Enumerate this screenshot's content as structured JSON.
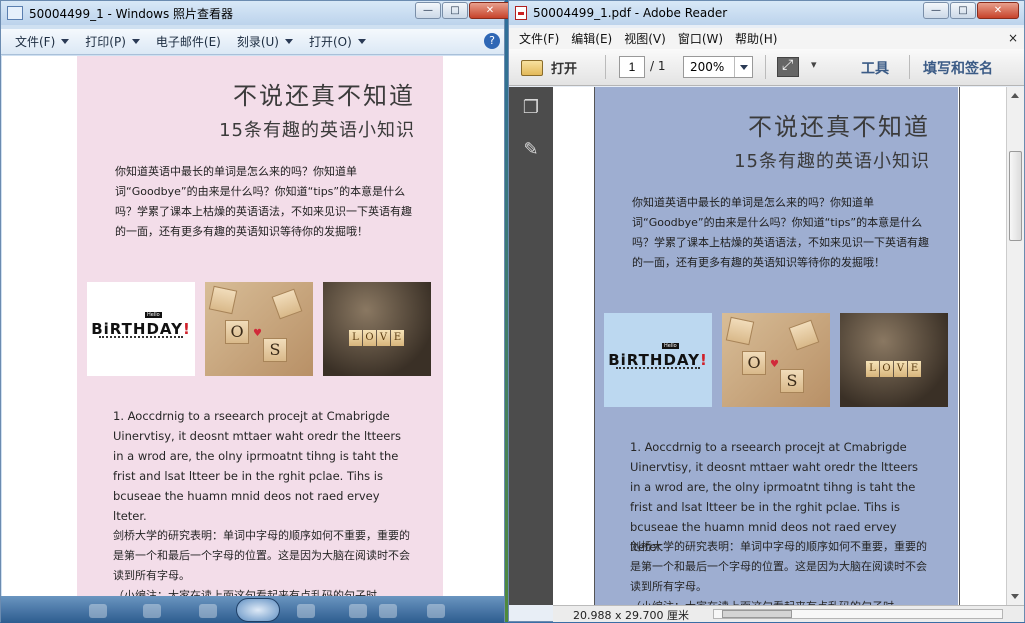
{
  "photo_viewer": {
    "title": "50004499_1 - Windows 照片查看器",
    "menu": [
      "文件(F)",
      "打印(P)",
      "电子邮件(E)",
      "刻录(U)",
      "打开(O)"
    ],
    "help": "?"
  },
  "reader": {
    "title": "50004499_1.pdf - Adobe Reader",
    "menu": [
      "文件(F)",
      "编辑(E)",
      "视图(V)",
      "窗口(W)",
      "帮助(H)"
    ],
    "close_doc": "×",
    "open_label": "打开",
    "page_current": "1",
    "page_total": "/ 1",
    "zoom": "200%",
    "tools_label": "工具",
    "sign_label": "填写和签名",
    "dimensions": "20.988 x 29.700 厘米"
  },
  "window_buttons": {
    "min": "—",
    "max": "□",
    "close": "✕"
  },
  "document": {
    "title_line1": "不说还真不知道",
    "title_line2": "15条有趣的英语小知识",
    "intro": "你知道英语中最长的单词是怎么来的吗？你知道单词“Goodbye”的由来是什么吗？你知道“tips”的本意是什么吗？学累了课本上枯燥的英语语法，不如来见识一下英语有趣的一面，还有更多有趣的英语知识等待你的发掘哦！",
    "image1_text": "BiRTHDAY",
    "image1_mark": "!",
    "image1_small": "Hello",
    "image2_letters": [
      "O",
      "S"
    ],
    "image3_letters": [
      "L",
      "O",
      "V",
      "E"
    ],
    "item1_en": "1. Aoccdrnig to a rseearch procejt at Cmabrigde Uinervtisy, it deosnt mttaer waht oredr the ltteers in a wrod are, the olny iprmoatnt tihng is taht the frist and lsat ltteer be in the rghit pclae. Tihs is bcuseae the huamn mnid deos not raed ervey lteter.",
    "item1_cn": "剑桥大学的研究表明：单词中字母的顺序如何不重要，重要的是第一个和最后一个字母的位置。这是因为大脑在阅读时不会读到所有字母。",
    "item1_note": "（小编注：大家在读上面这句看起来有点乱码的句子时"
  },
  "colors": {
    "pv_page_bg": "#f3dde9",
    "pdf_page_bg": "#9eaed1",
    "reader_accent": "#3b5b86"
  }
}
